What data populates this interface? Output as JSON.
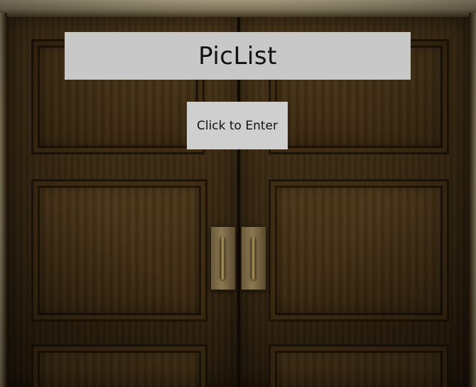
{
  "app": {
    "title": "PicList"
  },
  "main": {
    "enter_button_label": "Click to Enter"
  },
  "background": {
    "scene": "wooden-double-doors"
  },
  "colors": {
    "title_bar_bg": "#c8c8c8",
    "button_bg": "#cfcfcf",
    "text": "#111111"
  }
}
